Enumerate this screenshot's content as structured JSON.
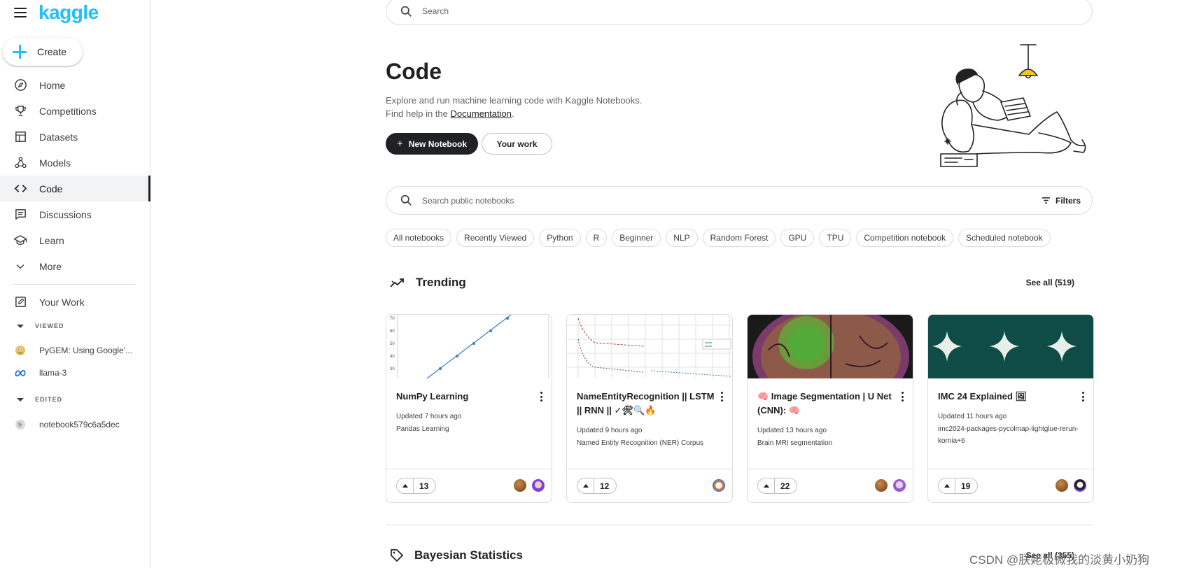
{
  "app": {
    "logo": "kaggle",
    "accent": "#20beff"
  },
  "sidebar": {
    "create_label": "Create",
    "items": [
      {
        "label": "Home",
        "icon": "compass-icon"
      },
      {
        "label": "Competitions",
        "icon": "trophy-icon"
      },
      {
        "label": "Datasets",
        "icon": "table-icon"
      },
      {
        "label": "Models",
        "icon": "models-icon"
      },
      {
        "label": "Code",
        "icon": "code-icon",
        "active": true
      },
      {
        "label": "Discussions",
        "icon": "comments-icon"
      },
      {
        "label": "Learn",
        "icon": "school-icon"
      },
      {
        "label": "More",
        "icon": "chevron-down-icon"
      }
    ],
    "your_work": {
      "label": "Your Work",
      "icon": "edit-note-icon"
    },
    "viewed_header": "VIEWED",
    "viewed": [
      {
        "label": "PyGEM: Using Google'...",
        "icon": "pygem-avatar"
      },
      {
        "label": "llama-3",
        "icon": "meta-logo"
      }
    ],
    "edited_header": "EDITED",
    "edited": [
      {
        "label": "notebook579c6a5dec",
        "icon": "notebook-avatar"
      }
    ]
  },
  "main": {
    "search_placeholder": "Search",
    "title": "Code",
    "desc_line1": "Explore and run machine learning code with Kaggle Notebooks.",
    "desc_line2_prefix": "Find help in the ",
    "desc_link": "Documentation",
    "desc_line2_suffix": ".",
    "new_notebook": "New Notebook",
    "your_work": "Your work",
    "notebook_search_placeholder": "Search public notebooks",
    "filters_label": "Filters",
    "chips": [
      "All notebooks",
      "Recently Viewed",
      "Python",
      "R",
      "Beginner",
      "NLP",
      "Random Forest",
      "GPU",
      "TPU",
      "Competition notebook",
      "Scheduled notebook"
    ],
    "trending": {
      "title": "Trending",
      "see_all": "See all (519)",
      "cards": [
        {
          "title": "NumPy Learning",
          "updated": "Updated 7 hours ago",
          "meta": "Pandas Learning",
          "votes": "13"
        },
        {
          "title": "NameEntityRecognition || LSTM || RNN || ✓🛠🔍🔥",
          "updated": "Updated 9 hours ago",
          "meta": "Named Entity Recognition (NER) Corpus",
          "votes": "12"
        },
        {
          "title": "🧠 Image Segmentation | U Net (CNN): 🧠",
          "updated": "Updated 13 hours ago",
          "meta": "Brain MRI segmentation",
          "votes": "22"
        },
        {
          "title": "IMC 24 Explained 🖼",
          "updated": "Updated 11 hours ago",
          "meta": "imc2024-packages-pycolmap-lightglue-rerun-kornia+6",
          "votes": "19"
        }
      ]
    },
    "bayesian": {
      "title": "Bayesian Statistics",
      "see_all": "See all (355)"
    }
  },
  "watermark": "CSDN @朕姥极微我的淡黄小奶狗"
}
